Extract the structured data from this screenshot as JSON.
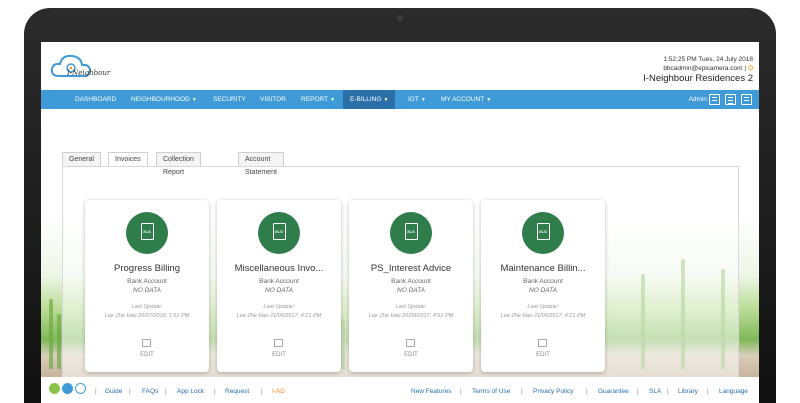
{
  "header": {
    "logo_text": "I-Neighbour",
    "time": "1:52:25 PM Tues, 24 July 2018",
    "email": "bbcadmin@epicamera.com |",
    "site": "I-Neighbour Residences 2"
  },
  "nav": {
    "items": [
      "DASHBOARD",
      "NEIGHBOURHOOD",
      "SECURITY",
      "VISITOR",
      "REPORT",
      "E-BILLING",
      "IOT",
      "MY ACCOUNT"
    ],
    "active": "E-BILLING",
    "admin": "Admin"
  },
  "tabs": [
    "General",
    "Invoices",
    "Collection Report",
    "Account Statement"
  ],
  "active_tab": "Invoices",
  "cards": [
    {
      "title": "Progress Billing",
      "sub": "Bank Account",
      "status": "NO DATA",
      "update_label": "Last Update:",
      "update_by": "Lee Zhe Hao 20/07/2018, 1:51 PM",
      "edit": "EDIT",
      "icon": "xls-file-icon"
    },
    {
      "title": "Miscellaneous Invo...",
      "sub": "Bank Account",
      "status": "NO DATA",
      "update_label": "Last Update:",
      "update_by": "Lee Zhe Hao 21/09/2017, 4:21 PM",
      "edit": "EDIT",
      "icon": "xls-file-icon"
    },
    {
      "title": "PS_Interest Advice",
      "sub": "Bank Account",
      "status": "NO DATA",
      "update_label": "Last Update:",
      "update_by": "Lee Zhe Hao 20/09/2017, 4:51 PM",
      "edit": "EDIT",
      "icon": "xls-file-icon"
    },
    {
      "title": "Maintenance Billin...",
      "sub": "Bank Account",
      "status": "NO DATA",
      "update_label": "Last Update:",
      "update_by": "Lee Zhe Hao 21/09/2017, 4:21 PM",
      "edit": "EDIT",
      "icon": "xls-file-icon"
    }
  ],
  "footer": {
    "left_links": [
      "Guide",
      "FAQs",
      "App Lock",
      "Request",
      "I-AD"
    ],
    "right_links": [
      "New Features",
      "Terms of Use",
      "Privacy Policy",
      "Guarantee",
      "SLA",
      "Library",
      "Language"
    ]
  },
  "colors": {
    "nav": "#3e9bd8",
    "nav_active": "#2a6fa8",
    "xls_green": "#2e7d4a",
    "link": "#2a6fa8",
    "accent_orange": "#f08a24"
  }
}
